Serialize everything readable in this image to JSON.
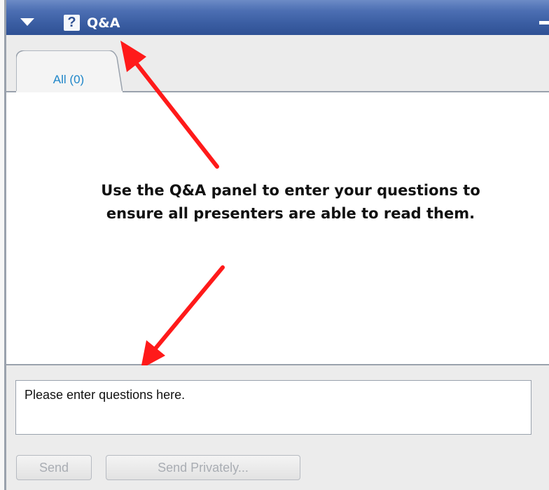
{
  "panel": {
    "title": "Q&A",
    "question_icon": "?",
    "icons": [
      "collapse-triangle-icon",
      "question-mark-icon",
      "minimize-icon"
    ]
  },
  "tabs": [
    {
      "label": "All (0)",
      "selected": true
    }
  ],
  "annotation": {
    "text": "Use the Q&A panel to enter your questions to ensure all presenters are able to read them.",
    "arrow_color": "#ff1a1a"
  },
  "compose": {
    "input_value": "Please enter questions here.",
    "send_label": "Send",
    "send_privately_label": "Send Privately..."
  },
  "colors": {
    "titlebar": "#3b5ea3",
    "tab_text": "#1f86c9",
    "panel_background": "#ececec",
    "disabled_text": "#a9adb3"
  }
}
